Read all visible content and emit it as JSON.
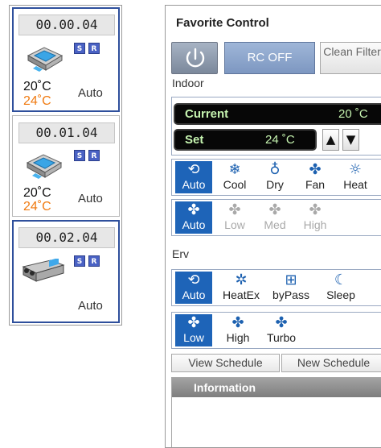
{
  "units": [
    {
      "id": "00.00.04",
      "badges": [
        "S",
        "R"
      ],
      "temp_current": "20˚C",
      "temp_set": "24˚C",
      "mode": "Auto",
      "device_icon": "cassette-ac-icon",
      "selected": true
    },
    {
      "id": "00.01.04",
      "badges": [
        "S",
        "R"
      ],
      "temp_current": "20˚C",
      "temp_set": "24˚C",
      "mode": "Auto",
      "device_icon": "cassette-ac-icon",
      "selected": false
    },
    {
      "id": "00.02.04",
      "badges": [
        "S",
        "R"
      ],
      "temp_current": "",
      "temp_set": "",
      "mode": "Auto",
      "device_icon": "erv-unit-icon",
      "selected": true
    }
  ],
  "control": {
    "title": "Favorite Control",
    "power_icon": "power-icon",
    "rc_off_label": "RC OFF",
    "clean_filter_label": "Clean Filter",
    "indoor_label": "Indoor",
    "current_label": "Current",
    "current_value": "20 ˚C",
    "set_label": "Set",
    "set_value": "24 ˚C",
    "up_arrow": "▲",
    "down_arrow": "▼",
    "indoor_modes": [
      {
        "label": "Auto",
        "icon": "auto-mode-icon",
        "state": "on"
      },
      {
        "label": "Cool",
        "icon": "snowflake-icon",
        "state": "normal"
      },
      {
        "label": "Dry",
        "icon": "droplet-icon",
        "state": "normal"
      },
      {
        "label": "Fan",
        "icon": "fan-icon",
        "state": "normal"
      },
      {
        "label": "Heat",
        "icon": "sun-icon",
        "state": "normal"
      }
    ],
    "indoor_fan_speeds": [
      {
        "label": "Auto",
        "icon": "fan-auto-icon",
        "state": "on"
      },
      {
        "label": "Low",
        "icon": "fan-low-icon",
        "state": "off"
      },
      {
        "label": "Med",
        "icon": "fan-med-icon",
        "state": "off"
      },
      {
        "label": "High",
        "icon": "fan-high-icon",
        "state": "off"
      }
    ],
    "erv_label": "Erv",
    "erv_modes": [
      {
        "label": "Auto",
        "icon": "auto-mode-icon",
        "state": "on"
      },
      {
        "label": "HeatEx",
        "icon": "heat-exchange-icon",
        "state": "normal"
      },
      {
        "label": "byPass",
        "icon": "bypass-icon",
        "state": "normal"
      },
      {
        "label": "Sleep",
        "icon": "sleep-icon",
        "state": "normal"
      }
    ],
    "erv_fan_speeds": [
      {
        "label": "Low",
        "icon": "fan-low-icon",
        "state": "on"
      },
      {
        "label": "High",
        "icon": "fan-high-icon",
        "state": "normal"
      },
      {
        "label": "Turbo",
        "icon": "fan-turbo-icon",
        "state": "normal"
      }
    ],
    "view_schedule_label": "View Schedule",
    "new_schedule_label": "New Schedule",
    "information_label": "Information"
  },
  "colors": {
    "accent_blue": "#1e64b8",
    "set_temp_orange": "#f07a10",
    "display_green": "#c6f4b0",
    "selection_border": "#2e4f9c"
  }
}
